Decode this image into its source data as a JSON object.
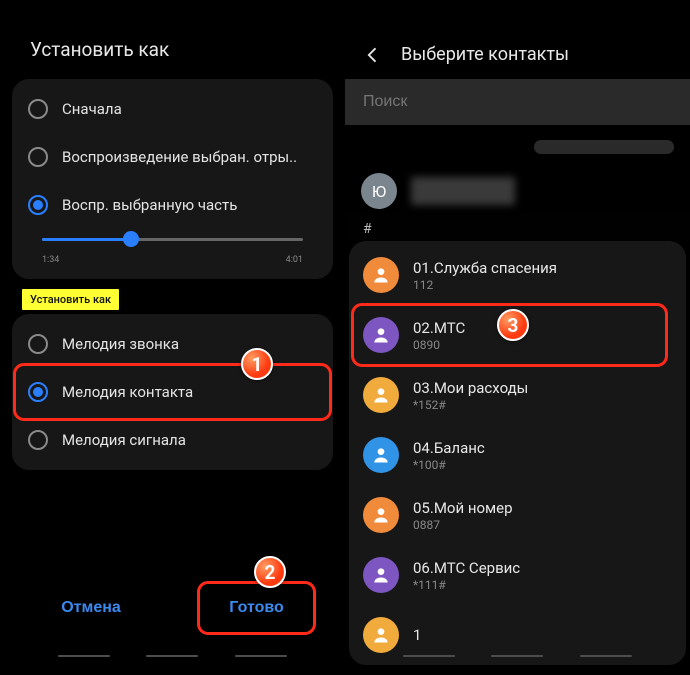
{
  "left": {
    "title": "Установить как",
    "playback": {
      "options": [
        "Сначала",
        "Воспроизведение выбран. отры..",
        "Воспр. выбранную часть"
      ],
      "selected_index": 2,
      "time_start": "1:34",
      "time_end": "4:01"
    },
    "section_chip": "Установить как",
    "set_as": {
      "options": [
        "Мелодия звонка",
        "Мелодия контакта",
        "Мелодия сигнала"
      ],
      "selected_index": 1
    },
    "cancel": "Отмена",
    "done": "Готово"
  },
  "right": {
    "header": "Выберите контакты",
    "search_placeholder": "Поиск",
    "my_letter": "Ю",
    "index_letter": "#",
    "contacts": [
      {
        "name": "01.Служба спасения",
        "sub": "112",
        "color": "#f18b3c"
      },
      {
        "name": "02.МТС",
        "sub": "0890",
        "color": "#7e56c1"
      },
      {
        "name": "03.Мои расходы",
        "sub": "*152#",
        "color": "#f1aa3c"
      },
      {
        "name": "04.Баланс",
        "sub": "*100#",
        "color": "#3193e6"
      },
      {
        "name": "05.Мой номер",
        "sub": "0887",
        "color": "#f18b3c"
      },
      {
        "name": "06.МТС Сервис",
        "sub": "*111#",
        "color": "#7e56c1"
      },
      {
        "name": "1",
        "sub": "",
        "color": "#f1aa3c"
      }
    ]
  },
  "badges": {
    "one": "1",
    "two": "2",
    "three": "3"
  }
}
